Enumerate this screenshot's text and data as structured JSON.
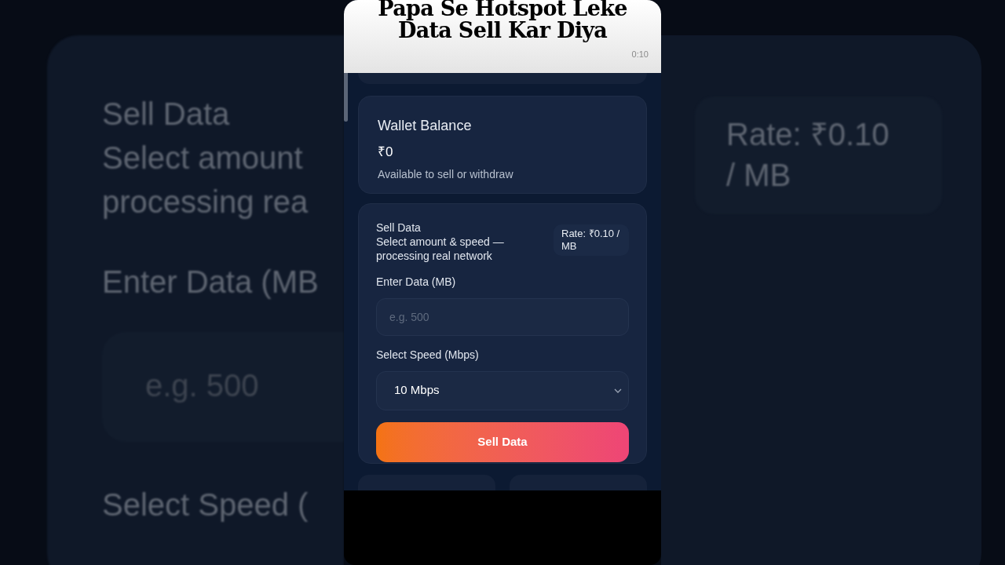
{
  "backdrop": {
    "left_texts": [
      "Sell Data",
      "Select amount",
      "processing rea",
      "Enter Data (MB",
      "e.g. 500",
      "Select Speed ("
    ],
    "right_texts": [
      "Rate: ₹0.10",
      "/ MB"
    ]
  },
  "caption": {
    "title": "Papa Se Hotspot Leke Data Sell Kar Diya",
    "timer": "0:10"
  },
  "wallet": {
    "title": "Wallet Balance",
    "amount": "₹0",
    "note": "Available to sell or withdraw"
  },
  "sell": {
    "title": "Sell Data",
    "subtitle": "Select amount & speed — processing real network",
    "rate": "Rate: ₹0.10 / MB",
    "data_label": "Enter Data (MB)",
    "data_placeholder": "e.g. 500",
    "speed_label": "Select Speed (Mbps)",
    "speed_value": "10 Mbps",
    "button": "Sell Data"
  }
}
